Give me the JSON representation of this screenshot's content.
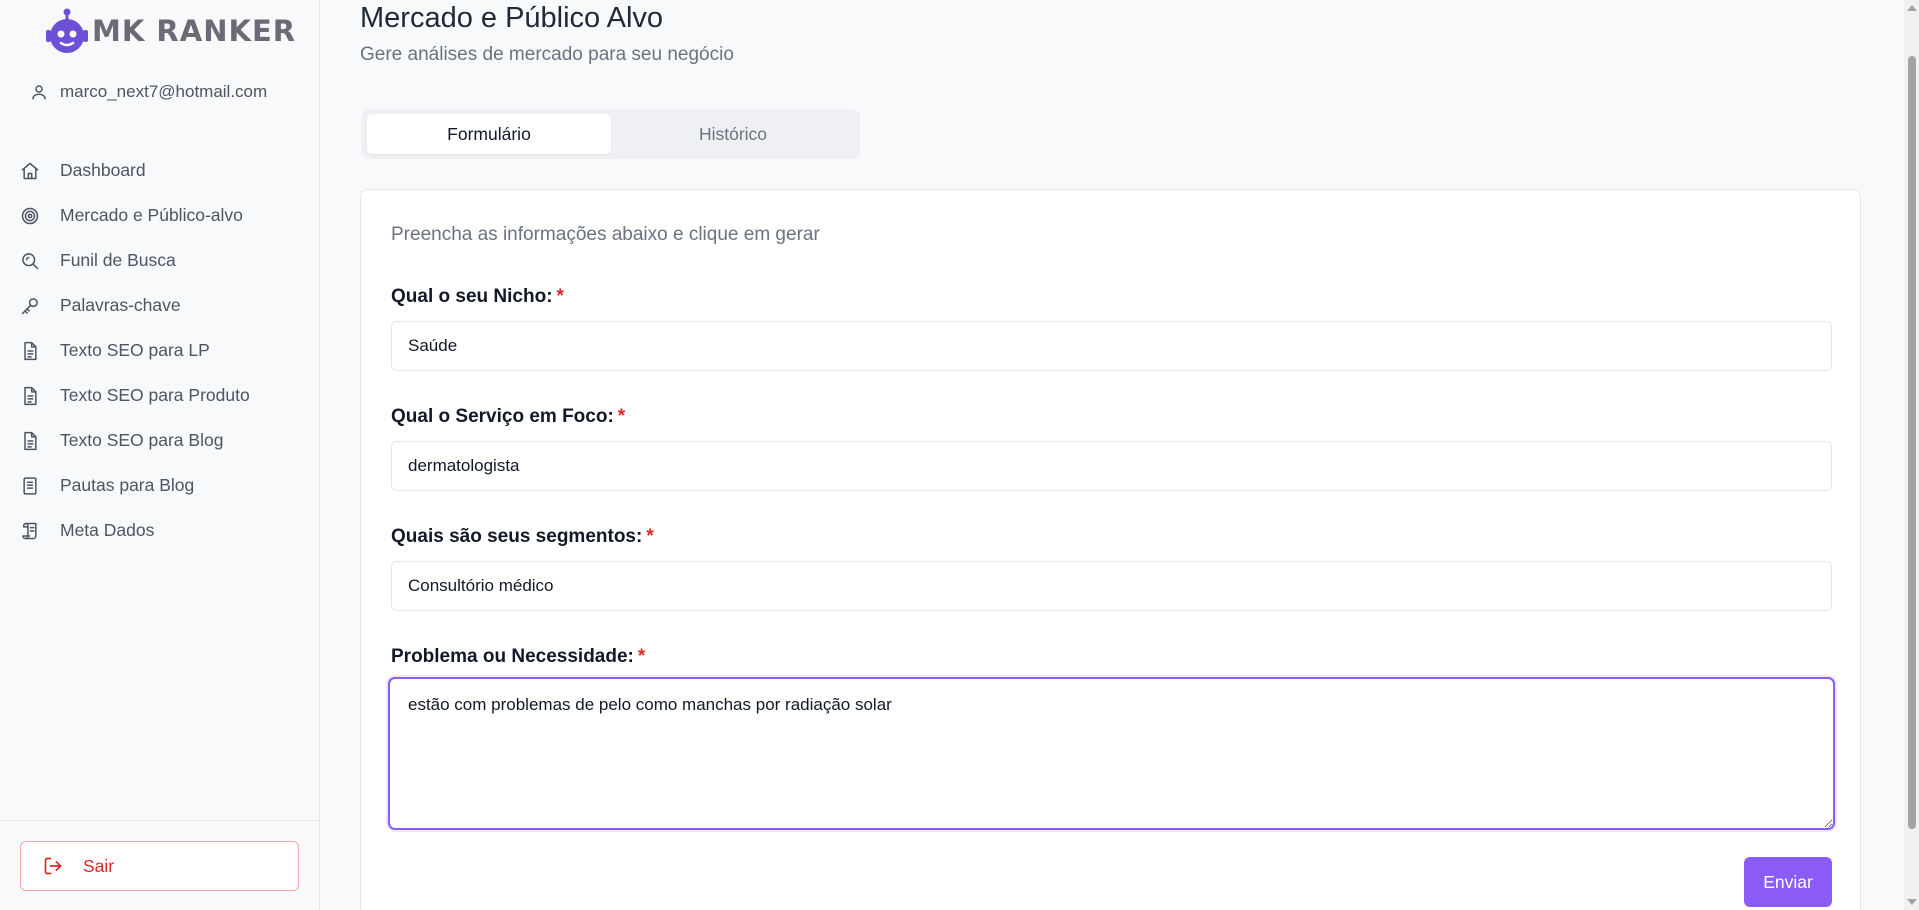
{
  "app": {
    "logo_text": "MK RANKER",
    "user_email": "marco_next7@hotmail.com"
  },
  "sidebar": {
    "items": [
      {
        "label": "Dashboard",
        "icon": "home-icon"
      },
      {
        "label": "Mercado e Público-alvo",
        "icon": "target-icon"
      },
      {
        "label": "Funil de Busca",
        "icon": "search-zoom-icon"
      },
      {
        "label": "Palavras-chave",
        "icon": "key-icon"
      },
      {
        "label": "Texto SEO para LP",
        "icon": "document-icon"
      },
      {
        "label": "Texto SEO para Produto",
        "icon": "document-icon"
      },
      {
        "label": "Texto SEO para Blog",
        "icon": "document-icon"
      },
      {
        "label": "Pautas para Blog",
        "icon": "notebook-icon"
      },
      {
        "label": "Meta Dados",
        "icon": "scroll-icon"
      }
    ],
    "logout_label": "Sair"
  },
  "header": {
    "title": "Mercado e Público Alvo",
    "subtitle": "Gere análises de mercado para seu negócio"
  },
  "tabs": [
    {
      "label": "Formulário",
      "active": true
    },
    {
      "label": "Histórico",
      "active": false
    }
  ],
  "form": {
    "description": "Preencha as informações abaixo e clique em gerar",
    "required_marker": "*",
    "fields": [
      {
        "label": "Qual o seu Nicho:",
        "value": "Saúde"
      },
      {
        "label": "Qual o Serviço em Foco:",
        "value": "dermatologista"
      },
      {
        "label": "Quais são seus segmentos:",
        "value": "Consultório médico"
      },
      {
        "label": "Problema ou Necessidade:",
        "value": "estão com problemas de pelo como manchas por radiação solar"
      }
    ],
    "submit_label": "Enviar"
  },
  "colors": {
    "accent": "#8b5cf6",
    "danger": "#dc2626",
    "logo": "#6d4fd8"
  }
}
